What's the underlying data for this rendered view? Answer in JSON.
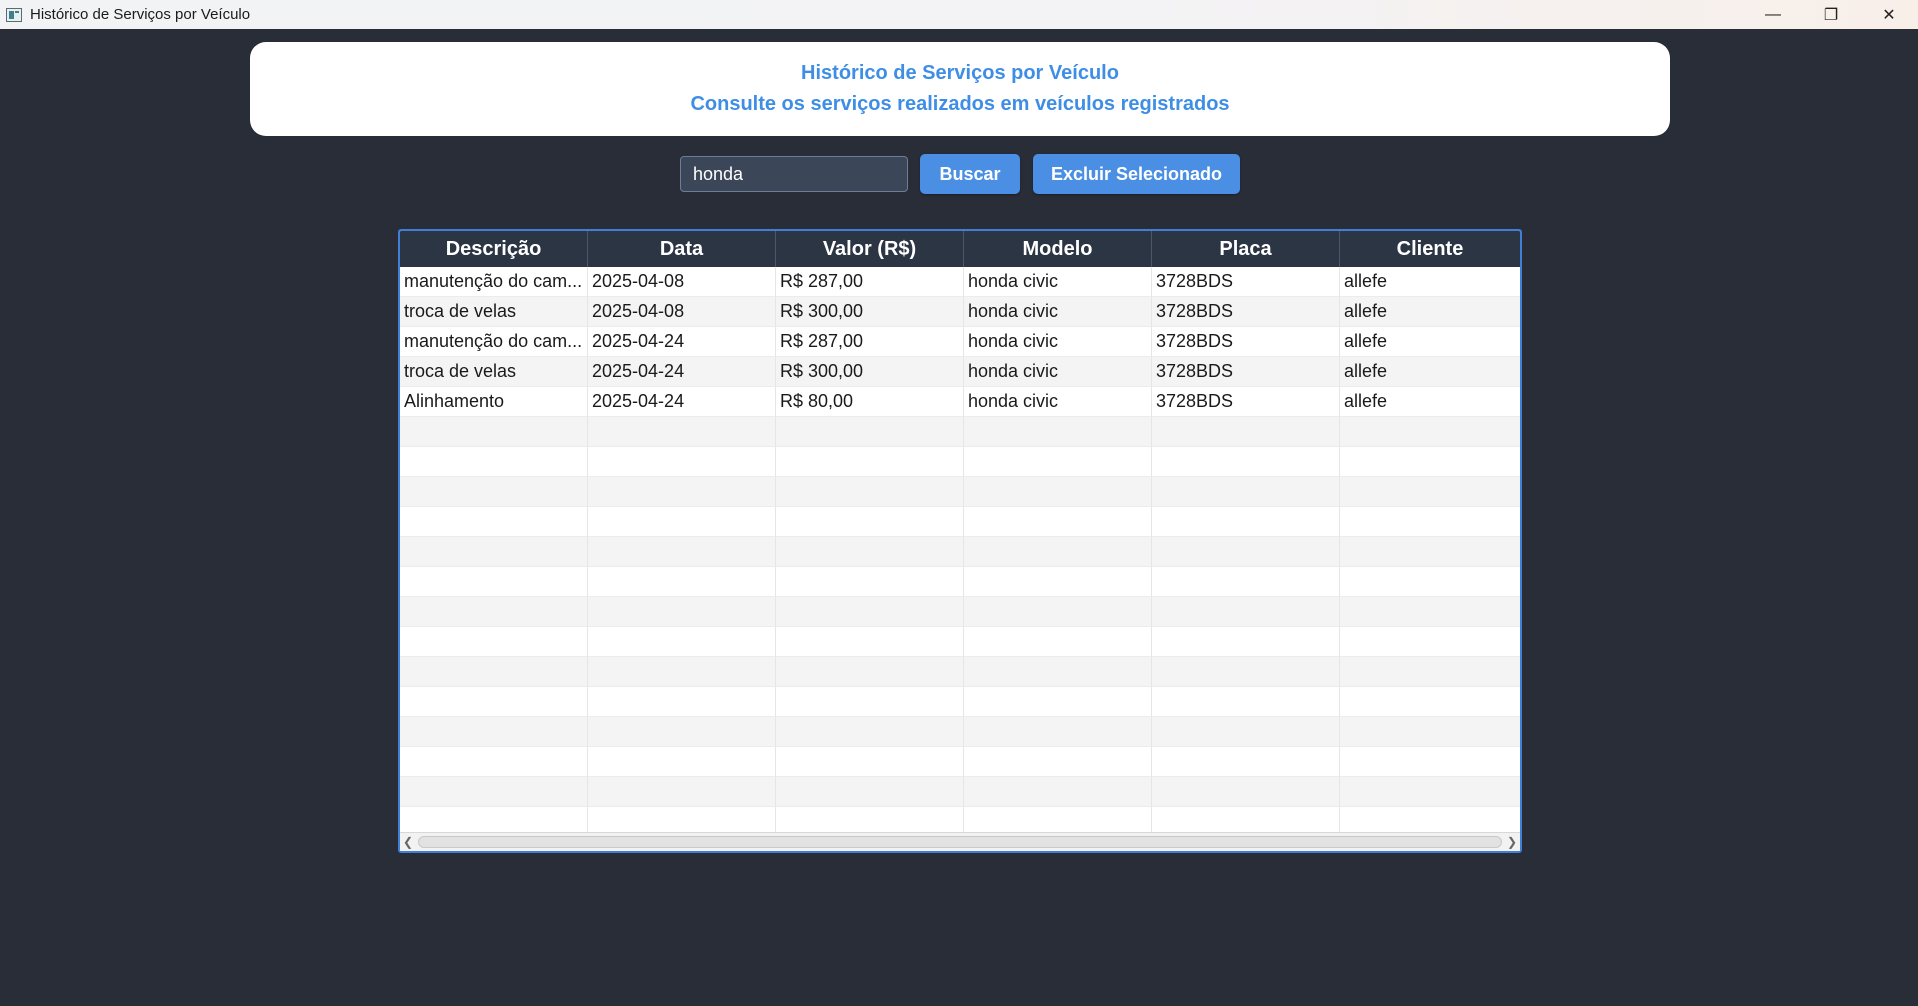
{
  "window": {
    "title": "Histórico de Serviços por Veículo",
    "controls": {
      "minimize": "—",
      "restore": "❐",
      "close": "✕"
    }
  },
  "header": {
    "title": "Histórico de Serviços por Veículo",
    "subtitle": "Consulte os serviços realizados em veículos registrados"
  },
  "search": {
    "value": "honda",
    "search_button": "Buscar",
    "delete_button": "Excluir Selecionado"
  },
  "table": {
    "columns": [
      "Descrição",
      "Data",
      "Valor (R$)",
      "Modelo",
      "Placa",
      "Cliente"
    ],
    "rows": [
      [
        "manutenção do cam...",
        "2025-04-08",
        "R$ 287,00",
        "honda civic",
        "3728BDS",
        "allefe"
      ],
      [
        "troca de velas",
        "2025-04-08",
        "R$ 300,00",
        "honda civic",
        "3728BDS",
        "allefe"
      ],
      [
        "manutenção do cam...",
        "2025-04-24",
        "R$ 287,00",
        "honda civic",
        "3728BDS",
        "allefe"
      ],
      [
        "troca de velas",
        "2025-04-24",
        "R$ 300,00",
        "honda civic",
        "3728BDS",
        "allefe"
      ],
      [
        "Alinhamento",
        "2025-04-24",
        "R$ 80,00",
        "honda civic",
        "3728BDS",
        "allefe"
      ]
    ]
  },
  "colors": {
    "background": "#292d38",
    "accent": "#4a8fe4",
    "header_text": "#3f8ee6",
    "table_header": "#2b3544"
  }
}
